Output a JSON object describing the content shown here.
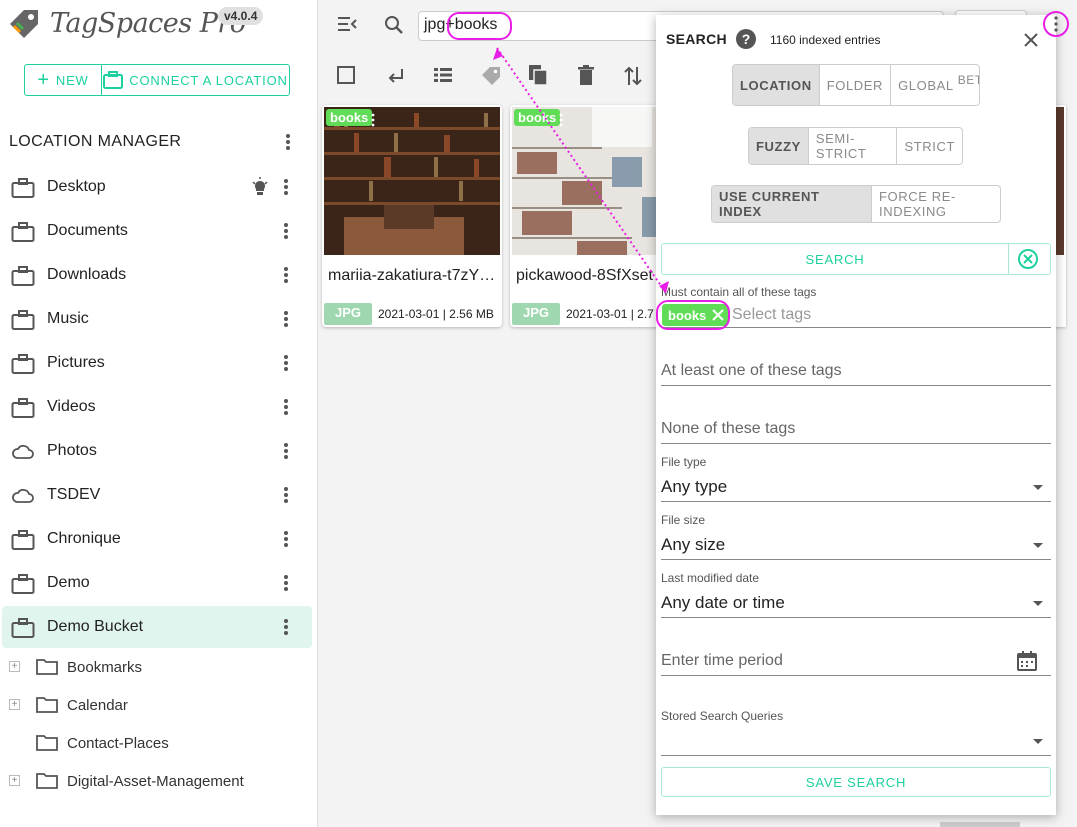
{
  "app": {
    "name": "TagSpaces Pro",
    "version": "v4.0.4"
  },
  "sidebar": {
    "new_label": "NEW",
    "connect_label": "CONNECT A LOCATION",
    "title": "LOCATION MANAGER",
    "locations": [
      {
        "label": "Desktop",
        "icon": "briefcase-icon"
      },
      {
        "label": "Documents",
        "icon": "briefcase-icon"
      },
      {
        "label": "Downloads",
        "icon": "briefcase-icon"
      },
      {
        "label": "Music",
        "icon": "briefcase-icon"
      },
      {
        "label": "Pictures",
        "icon": "briefcase-icon"
      },
      {
        "label": "Videos",
        "icon": "briefcase-icon"
      },
      {
        "label": "Photos",
        "icon": "cloud-icon"
      },
      {
        "label": "TSDEV",
        "icon": "cloud-icon"
      },
      {
        "label": "Chronique",
        "icon": "briefcase-icon"
      },
      {
        "label": "Demo",
        "icon": "briefcase-icon"
      },
      {
        "label": "Demo Bucket",
        "icon": "briefcase-icon",
        "active": true
      }
    ],
    "folders": [
      {
        "label": "Bookmarks",
        "expandable": true
      },
      {
        "label": "Calendar",
        "expandable": true
      },
      {
        "label": "Contact-Places",
        "expandable": false
      },
      {
        "label": "Digital-Asset-Management",
        "expandable": true
      }
    ]
  },
  "search": {
    "query_prefix": "jpg",
    "query_tag": "+books"
  },
  "files": [
    {
      "name": "mariia-zakatiura-t7zY…",
      "tag": "books",
      "ext": "JPG",
      "meta": "2021-03-01 | 2.56 MB"
    },
    {
      "name": "pickawood-8SfXset",
      "tag": "books",
      "ext": "JPG",
      "meta": "2021-03-01 | 2.7"
    }
  ],
  "panel": {
    "title": "SEARCH",
    "indexed": "1160 indexed entries",
    "scope": {
      "options": [
        "LOCATION",
        "FOLDER",
        "GLOBAL"
      ],
      "global_badge": "BETA",
      "selected": "LOCATION"
    },
    "mode": {
      "options": [
        "FUZZY",
        "SEMI-STRICT",
        "STRICT"
      ],
      "selected": "FUZZY"
    },
    "index": {
      "options": [
        "USE CURRENT INDEX",
        "FORCE RE-INDEXING"
      ],
      "selected": "USE CURRENT INDEX"
    },
    "search_button": "SEARCH",
    "must_label": "Must contain all of these tags",
    "must_tag": "books",
    "must_placeholder": "Select tags",
    "any_label": "At least one of these tags",
    "none_label": "None of these tags",
    "file_type_label": "File type",
    "file_type_value": "Any type",
    "file_size_label": "File size",
    "file_size_value": "Any size",
    "modified_label": "Last modified date",
    "modified_value": "Any date or time",
    "time_period_placeholder": "Enter time period",
    "stored_label": "Stored Search Queries",
    "save_button": "SAVE SEARCH"
  },
  "colors": {
    "accent": "#1dd19f",
    "tag": "#61dc57",
    "annotation": "#e91ee6"
  }
}
